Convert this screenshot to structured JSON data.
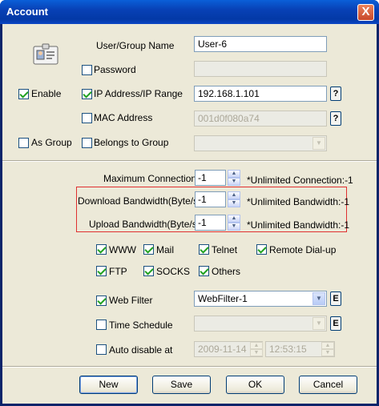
{
  "window": {
    "title": "Account",
    "close_glyph": "X"
  },
  "user": {
    "name_label": "User/Group Name",
    "name_value": "User-6",
    "password_label": "Password",
    "password_checked": false,
    "password_value": ""
  },
  "enable": {
    "label": "Enable",
    "checked": true
  },
  "ip": {
    "label": "IP Address/IP Range",
    "checked": true,
    "value": "192.168.1.101",
    "help": "?"
  },
  "mac": {
    "label": "MAC Address",
    "checked": false,
    "value": "001d0f080a74",
    "help": "?"
  },
  "group": {
    "as_group_label": "As Group",
    "as_group_checked": false,
    "belongs_label": "Belongs to Group",
    "belongs_checked": false,
    "belongs_value": ""
  },
  "limits": {
    "max_conn_label": "Maximum Connections",
    "max_conn_value": "-1",
    "max_conn_note": "*Unlimited Connection:-1",
    "download_label": "Download Bandwidth(Byte/s)",
    "download_value": "-1",
    "download_note": "*Unlimited Bandwidth:-1",
    "upload_label": "Upload Bandwidth(Byte/s)",
    "upload_value": "-1",
    "upload_note": "*Unlimited Bandwidth:-1"
  },
  "services": {
    "www": {
      "label": "WWW",
      "checked": true
    },
    "mail": {
      "label": "Mail",
      "checked": true
    },
    "telnet": {
      "label": "Telnet",
      "checked": true
    },
    "remote": {
      "label": "Remote Dial-up",
      "checked": true
    },
    "ftp": {
      "label": "FTP",
      "checked": true
    },
    "socks": {
      "label": "SOCKS",
      "checked": true
    },
    "others": {
      "label": "Others",
      "checked": true
    }
  },
  "filters": {
    "web_filter_label": "Web Filter",
    "web_filter_checked": true,
    "web_filter_value": "WebFilter-1",
    "web_filter_edit": "E",
    "schedule_label": "Time Schedule",
    "schedule_checked": false,
    "schedule_value": "",
    "schedule_edit": "E",
    "auto_disable_label": "Auto disable at",
    "auto_disable_checked": false,
    "auto_date": "2009-11-14",
    "auto_time": "12:53:15"
  },
  "buttons": {
    "new": "New",
    "save": "Save",
    "ok": "OK",
    "cancel": "Cancel"
  },
  "colors": {
    "highlight_border": "#e03030",
    "title_bar": "#0841b6",
    "dialog_bg": "#ece9d8"
  }
}
